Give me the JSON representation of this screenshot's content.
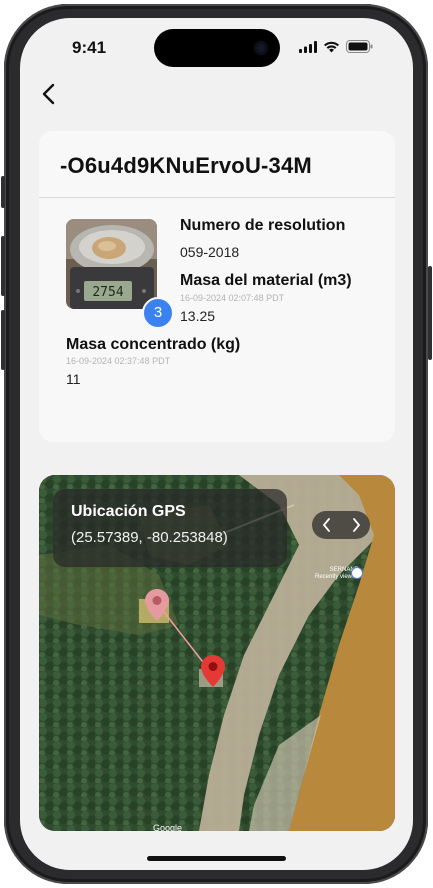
{
  "status_bar": {
    "time": "9:41"
  },
  "record": {
    "id": "-O6u4d9KNuErvoU-34M",
    "photo_count": "3",
    "fields": {
      "resolution": {
        "label": "Numero de resolution",
        "value": "059-2018"
      },
      "material_mass": {
        "label": "Masa del material (m3)",
        "timestamp": "16-09-2024 02:07:48 PDT",
        "value": "13.25"
      },
      "concentrate_mass": {
        "label": "Masa concentrado (kg)",
        "timestamp": "16-09-2024 02:37:48 PDT",
        "value": "11"
      }
    }
  },
  "map": {
    "gps_title": "Ubicación GPS",
    "gps_coords": "(25.57389, -80.253848)",
    "place_label_1": "SERNANP",
    "place_label_2": "Recently viewed",
    "attribution": "Google"
  },
  "colors": {
    "badge": "#3b82f0",
    "pin_primary": "#e53935",
    "pin_secondary": "#e59aa0"
  }
}
